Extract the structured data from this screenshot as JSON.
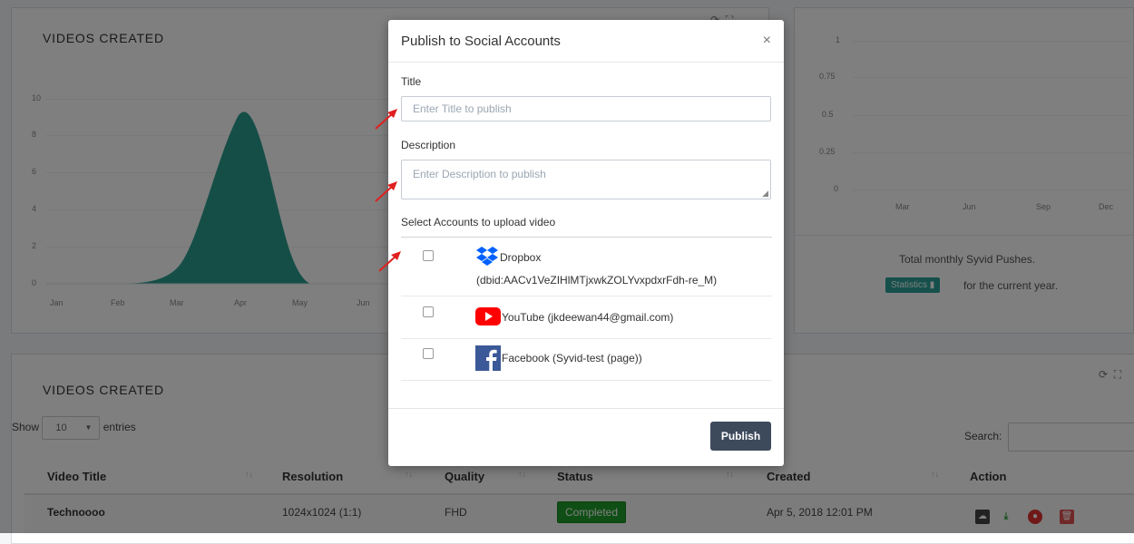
{
  "colors": {
    "chart_fill": "#2a9d8f",
    "accent": "#3d4a5c",
    "completed": "#1e9e2a",
    "dropbox_blue": "#0061ff",
    "youtube_red": "#ff0000",
    "facebook_blue": "#3b5998",
    "arrow_red": "#e02020"
  },
  "left_panel": {
    "title": "VIDEOS CREATED"
  },
  "chart_data": [
    {
      "type": "area",
      "title": "VIDEOS CREATED",
      "x": [
        "Jan",
        "Feb",
        "Mar",
        "Apr",
        "May",
        "Jun"
      ],
      "y_ticks": [
        "0",
        "2",
        "4",
        "6",
        "8",
        "10"
      ],
      "ylim": [
        0,
        10
      ],
      "values": [
        0,
        0,
        1,
        9,
        0,
        0
      ]
    },
    {
      "type": "line",
      "x": [
        "Mar",
        "Jun",
        "Sep",
        "Dec"
      ],
      "y_ticks": [
        "0",
        "0.25",
        "0.5",
        "0.75",
        "1"
      ],
      "ylim": [
        0,
        1
      ],
      "values": []
    }
  ],
  "right_panel": {
    "caption": "Total monthly Syvid Pushes.",
    "stat_button": "Statistics",
    "stat_suffix": "for the current year."
  },
  "bottom_panel": {
    "title": "VIDEOS CREATED",
    "show_label": "Show",
    "entries_value": "10",
    "entries_label": "entries",
    "search_label": "Search:",
    "columns": [
      "Video Title",
      "Resolution",
      "Quality",
      "Status",
      "Created",
      "Action"
    ],
    "rows": [
      {
        "title": "Technoooo",
        "resolution": "1024x1024 (1:1)",
        "quality": "FHD",
        "status": "Completed",
        "created": "Apr 5, 2018 12:01 PM"
      }
    ]
  },
  "modal": {
    "title": "Publish to Social Accounts",
    "close": "×",
    "title_label": "Title",
    "title_placeholder": "Enter Title to publish",
    "desc_label": "Description",
    "desc_placeholder": "Enter Description to publish",
    "accounts_label": "Select Accounts to upload video",
    "accounts": [
      {
        "icon": "dropbox-icon",
        "name": "Dropbox",
        "detail": "(dbid:AACv1VeZIHlMTjxwkZOLYvxpdxrFdh-re_M)"
      },
      {
        "icon": "youtube-icon",
        "name": "YouTube (jkdeewan44@gmail.com)"
      },
      {
        "icon": "facebook-icon",
        "name": "Facebook (Syvid-test (page))"
      }
    ],
    "publish_button": "Publish"
  }
}
